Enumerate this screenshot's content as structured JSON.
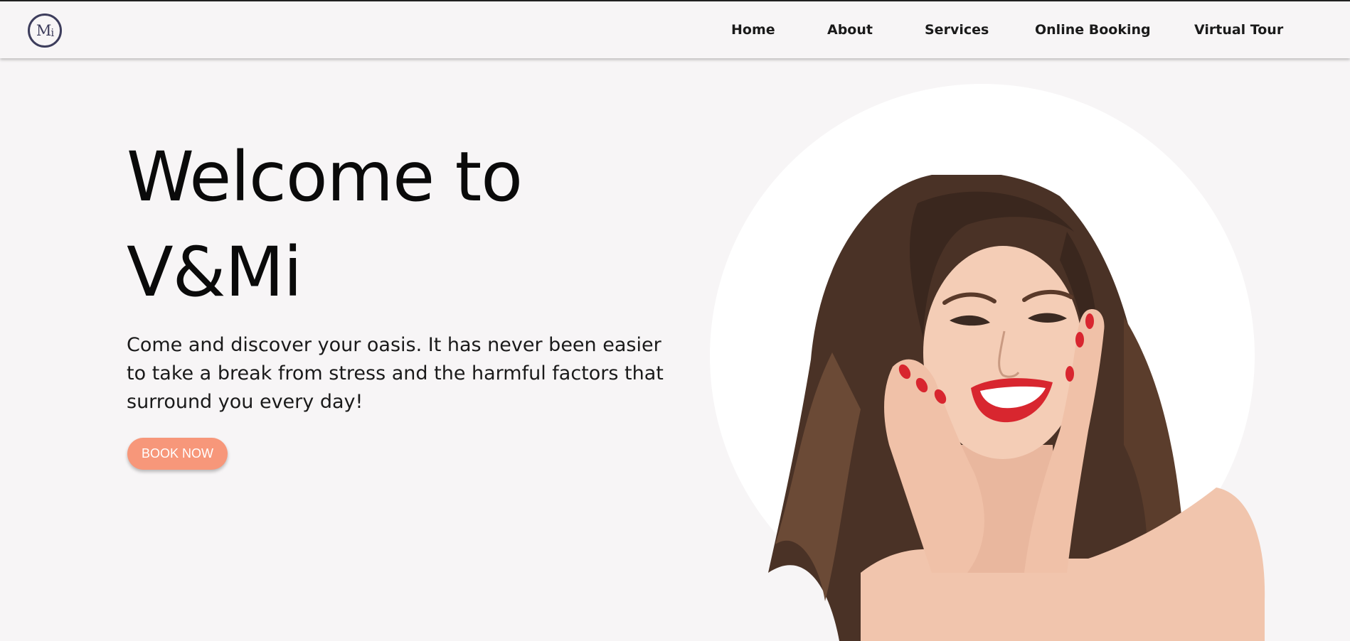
{
  "brand": {
    "logo_text": "Mi",
    "logo_main": "M",
    "logo_sub": "i"
  },
  "nav": {
    "items": [
      {
        "label": "Home"
      },
      {
        "label": "About"
      },
      {
        "label": "Services"
      },
      {
        "label": "Online Booking"
      },
      {
        "label": "Virtual Tour"
      }
    ]
  },
  "hero": {
    "title_line1": "Welcome to",
    "title_line2": "V&Mi",
    "description": "Come and discover your oasis. It has never been easier to take a break from stress and the harmful factors that surround you every day!",
    "cta_label": "BOOK NOW"
  },
  "colors": {
    "background": "#f7f5f6",
    "accent": "#f7977a",
    "logo": "#3d3d5c",
    "circle": "#ffffff",
    "lipstick": "#d8262f"
  }
}
